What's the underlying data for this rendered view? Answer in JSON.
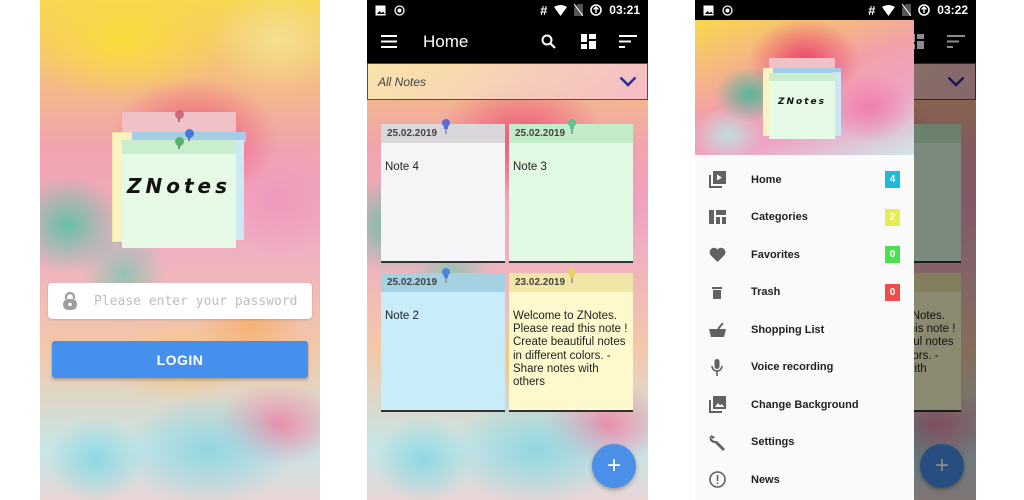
{
  "screens": {
    "login": {
      "logo_text": "ZNotes",
      "password_placeholder": "Please enter your password",
      "password_value": "",
      "login_label": "LOGIN",
      "colors": {
        "login_button": "#4490ec"
      }
    },
    "home": {
      "status_bar": {
        "time": "03:21"
      },
      "app_bar": {
        "title": "Home"
      },
      "category_selector": {
        "selected": "All Notes"
      },
      "notes": [
        {
          "date": "25.02.2019",
          "text": "Note 4",
          "color": "#f5f4f6",
          "head_color": "#d9d7d9",
          "pin_color": "#5a6ad8"
        },
        {
          "date": "25.02.2019",
          "text": "Note 3",
          "color": "#e2fae3",
          "head_color": "#c3ecc8",
          "pin_color": "#62c48a"
        },
        {
          "date": "25.02.2019",
          "text": "Note 2",
          "color": "#c9ecf9",
          "head_color": "#a4d2e2",
          "pin_color": "#4a86e0"
        },
        {
          "date": "23.02.2019",
          "text": "Welcome to ZNotes. Please read this note ! Create beautiful notes in different colors. - Share notes with others",
          "color": "#fdf9cd",
          "head_color": "#efe6a8",
          "pin_color": "#e4d16a"
        }
      ],
      "fab_label": "+"
    },
    "drawer": {
      "status_bar": {
        "time": "03:22"
      },
      "logo_text": "ZNotes",
      "menu": [
        {
          "label": "Home",
          "icon": "video-library-icon",
          "badge": "4",
          "badge_color": "#1fb8d8"
        },
        {
          "label": "Categories",
          "icon": "dashboard-icon",
          "badge": "2",
          "badge_color": "#e7ec52"
        },
        {
          "label": "Favorites",
          "icon": "heart-icon",
          "badge": "0",
          "badge_color": "#4be04f"
        },
        {
          "label": "Trash",
          "icon": "trash-icon",
          "badge": "0",
          "badge_color": "#f24b4b"
        },
        {
          "label": "Shopping List",
          "icon": "basket-icon"
        },
        {
          "label": "Voice recording",
          "icon": "microphone-icon"
        },
        {
          "label": "Change Background",
          "icon": "photo-library-icon"
        },
        {
          "label": "Settings",
          "icon": "wrench-icon"
        },
        {
          "label": "News",
          "icon": "info-circle-icon"
        }
      ],
      "bg_note_text": "Welcome to ZNotes. Please read this note ! Create beautiful notes in different colors. - Share notes with others",
      "fab_label": "+"
    }
  }
}
